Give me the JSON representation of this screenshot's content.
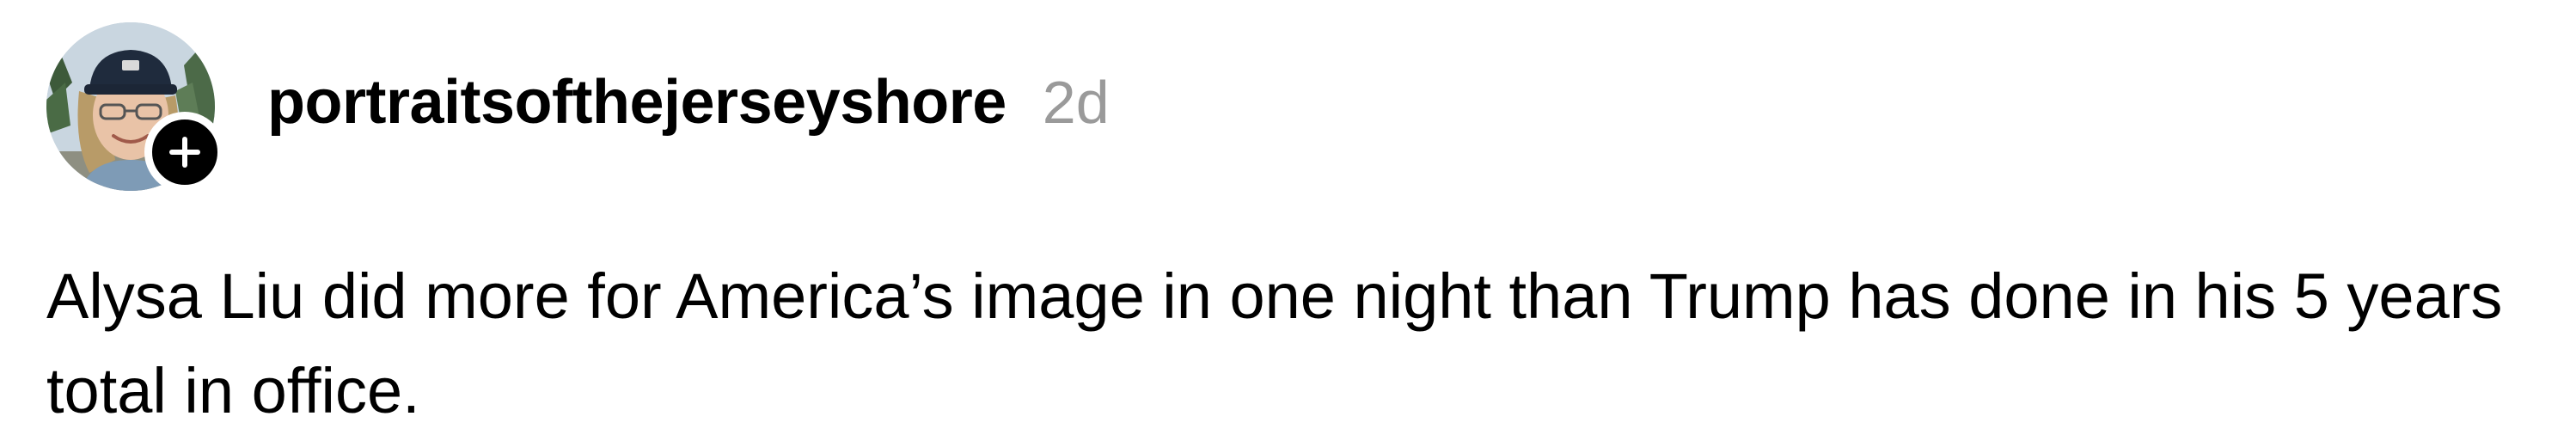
{
  "post": {
    "username": "portraitsofthejerseyshore",
    "timestamp": "2d",
    "text": "Alysa Liu did more for America’s image in one night than Trump has done in his 5 years total in office.",
    "avatar_icon": "user-avatar-photo",
    "follow_icon": "plus-icon"
  },
  "colors": {
    "text": "#000000",
    "timestamp": "#9a9a9a",
    "background": "#ffffff",
    "badge": "#000000"
  }
}
